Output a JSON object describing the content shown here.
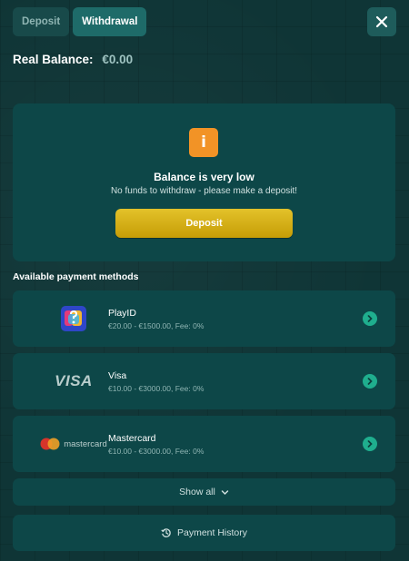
{
  "tabs": [
    {
      "label": "Deposit",
      "active": false
    },
    {
      "label": "Withdrawal",
      "active": true
    }
  ],
  "header": {
    "close_icon": "close-icon"
  },
  "balance": {
    "label": "Real Balance:",
    "amount": "€0.00"
  },
  "notice": {
    "icon": "info-icon",
    "title": "Balance is very low",
    "subtitle": "No funds to withdraw - please make a deposit!",
    "button_label": "Deposit"
  },
  "methods_title": "Available payment methods",
  "methods": [
    {
      "name": "PlayID",
      "range": "€20.00 - €1500.00, Fee: 0%",
      "logo": "playid-logo"
    },
    {
      "name": "Visa",
      "range": "€10.00 - €3000.00, Fee: 0%",
      "logo": "visa-logo",
      "logo_text": "VISA"
    },
    {
      "name": "Mastercard",
      "range": "€10.00 - €3000.00, Fee: 0%",
      "logo": "mastercard-logo",
      "logo_text": "mastercard"
    }
  ],
  "show_all_label": "Show all",
  "history_label": "Payment History",
  "colors": {
    "background": "#0f3536",
    "card": "#0d4748",
    "accent": "#1fae8e",
    "deposit_button": "#d4ad16",
    "info_icon": "#f29326"
  }
}
